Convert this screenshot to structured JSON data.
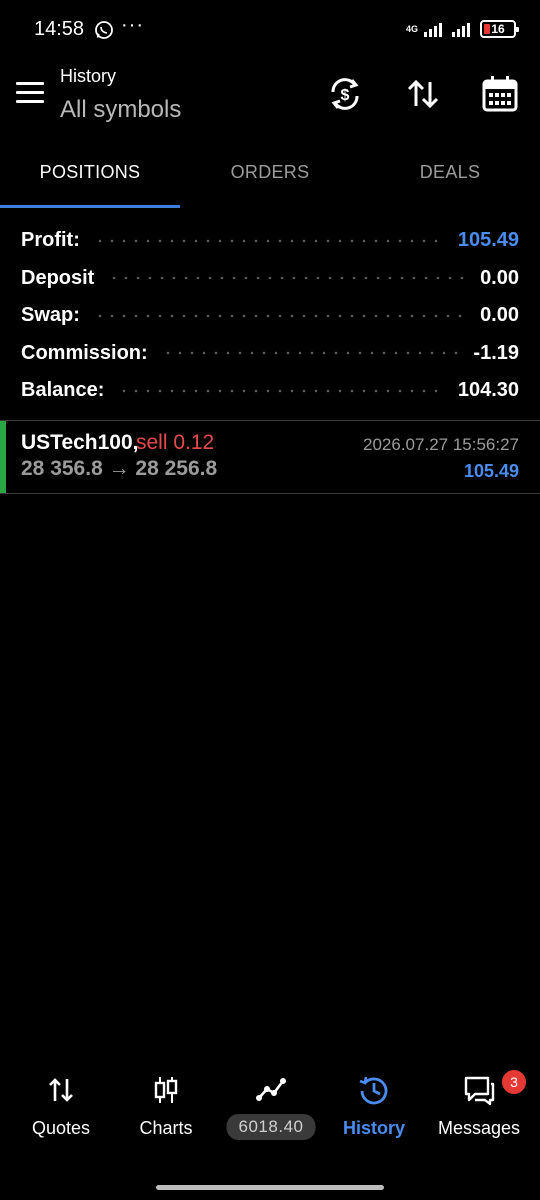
{
  "status_bar": {
    "time": "14:58",
    "network": "4G",
    "battery": "16",
    "battery_color": "#e53935"
  },
  "header": {
    "title": "History",
    "subtitle": "All symbols"
  },
  "tabs": [
    {
      "label": "POSITIONS",
      "active": true
    },
    {
      "label": "ORDERS",
      "active": false
    },
    {
      "label": "DEALS",
      "active": false
    }
  ],
  "summary": {
    "profit": {
      "label": "Profit:",
      "value": "105.49"
    },
    "deposit": {
      "label": "Deposit",
      "value": "0.00"
    },
    "swap": {
      "label": "Swap:",
      "value": "0.00"
    },
    "commission": {
      "label": "Commission:",
      "value": "-1.19"
    },
    "balance": {
      "label": "Balance:",
      "value": "104.30"
    }
  },
  "positions": [
    {
      "symbol": "USTech100,",
      "side": "sell 0.12",
      "prices": "28 356.8 → 28 256.8",
      "time": "2026.07.27 15:56:27",
      "profit": "105.49"
    }
  ],
  "bottom_nav": {
    "quotes": "Quotes",
    "charts": "Charts",
    "trade_pill": "6018.40",
    "history": "History",
    "messages": "Messages",
    "messages_badge": "3"
  },
  "colors": {
    "accent": "#3d7dde",
    "profit_blue": "#4a8cf0",
    "sell_red": "#e24b4b",
    "position_bar": "#29a745"
  }
}
